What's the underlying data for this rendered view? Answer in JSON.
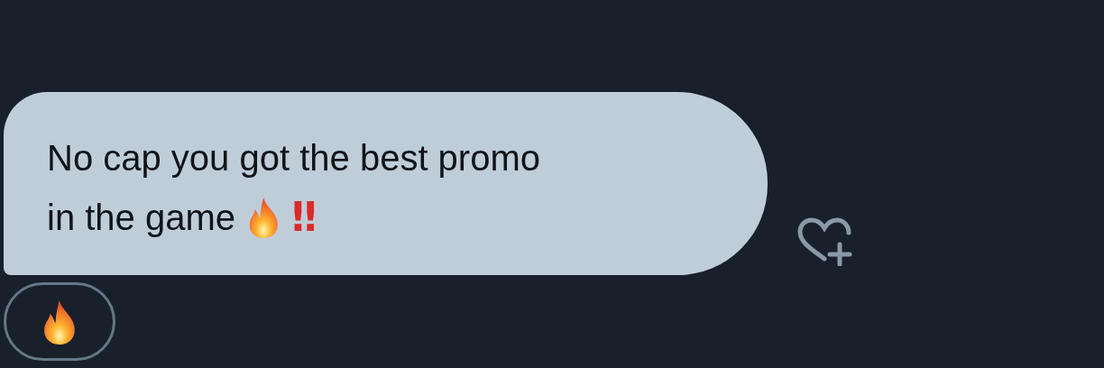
{
  "message": {
    "lines": [
      {
        "parts": [
          {
            "kind": "text",
            "text": "No cap you got the best promo"
          }
        ]
      },
      {
        "parts": [
          {
            "kind": "text",
            "text": "in the game"
          },
          {
            "kind": "fire"
          },
          {
            "kind": "mark",
            "text": "‼"
          }
        ]
      }
    ]
  },
  "reactions": [
    {
      "kind": "fire"
    }
  ]
}
